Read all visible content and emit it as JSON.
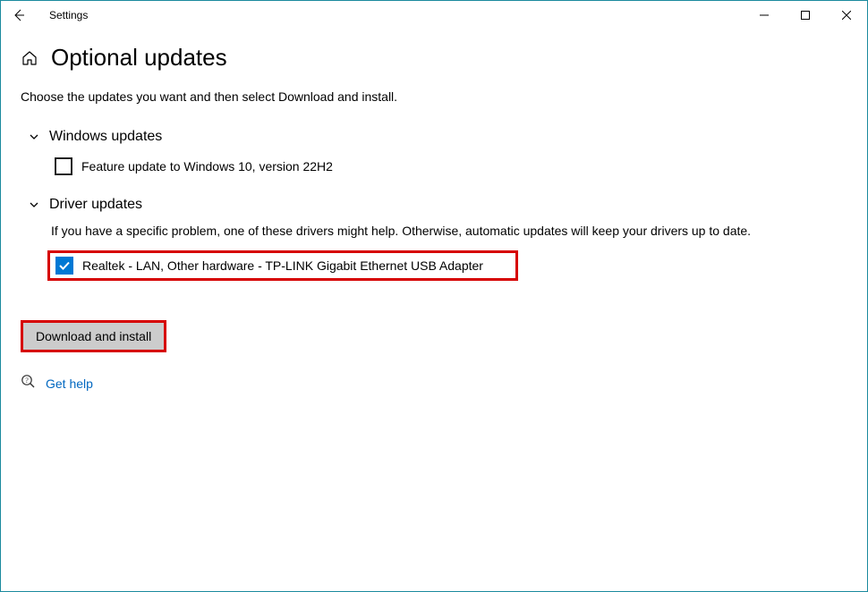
{
  "window": {
    "title": "Settings"
  },
  "page": {
    "title": "Optional updates",
    "subtitle": "Choose the updates you want and then select Download and install."
  },
  "sections": {
    "windows": {
      "title": "Windows updates",
      "item": "Feature update to Windows 10, version 22H2"
    },
    "drivers": {
      "title": "Driver updates",
      "desc": "If you have a specific problem, one of these drivers might help. Otherwise, automatic updates will keep your drivers up to date.",
      "item": "Realtek - LAN, Other hardware - TP-LINK Gigabit Ethernet USB Adapter"
    }
  },
  "actions": {
    "download": "Download and install",
    "help": "Get help"
  }
}
